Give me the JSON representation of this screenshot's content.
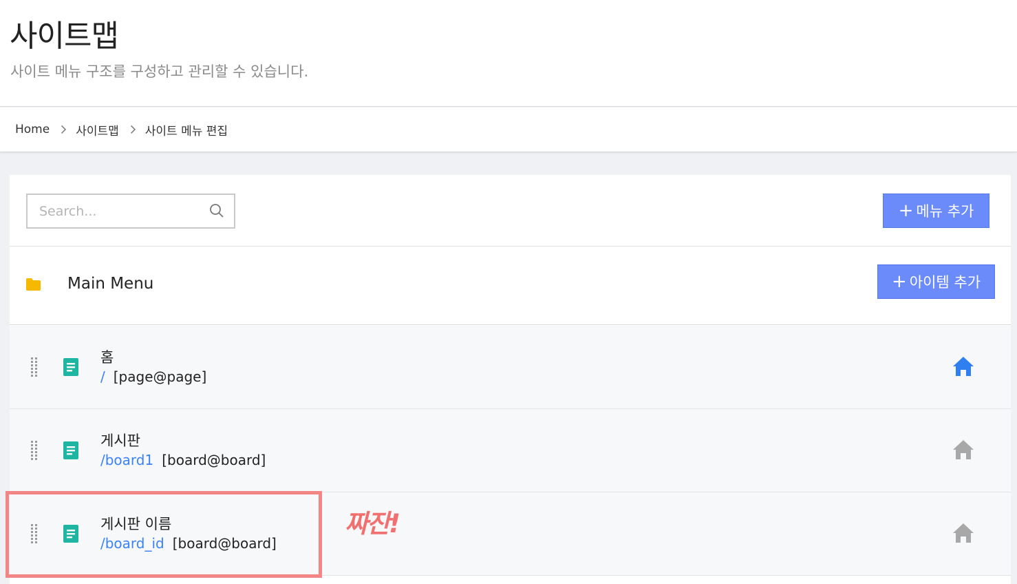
{
  "header": {
    "title": "사이트맵",
    "subtitle": "사이트 메뉴 구조를 구성하고 관리할 수 있습니다."
  },
  "breadcrumb": [
    "Home",
    "사이트맵",
    "사이트 메뉴 편집"
  ],
  "toolbar": {
    "search_placeholder": "Search...",
    "add_menu_label": "메뉴 추가"
  },
  "menu": {
    "title": "Main Menu",
    "add_item_label": "아이템 추가",
    "items": [
      {
        "name": "홈",
        "url": "/",
        "module": "[page@page]",
        "is_home": true
      },
      {
        "name": "게시판",
        "url": "/board1",
        "module": "[board@board]",
        "is_home": false
      },
      {
        "name": "게시판 이름",
        "url": "/board_id",
        "module": "[board@board]",
        "is_home": false
      }
    ]
  },
  "annotation": {
    "text": "짜잔!"
  },
  "colors": {
    "primary": "#6b8bfa",
    "link": "#3b82f6",
    "doc_icon": "#1fb5a3",
    "home_active": "#2f7ff0",
    "home_inactive": "#a8a8a8",
    "folder": "#f6b800",
    "highlight": "#f48585"
  }
}
